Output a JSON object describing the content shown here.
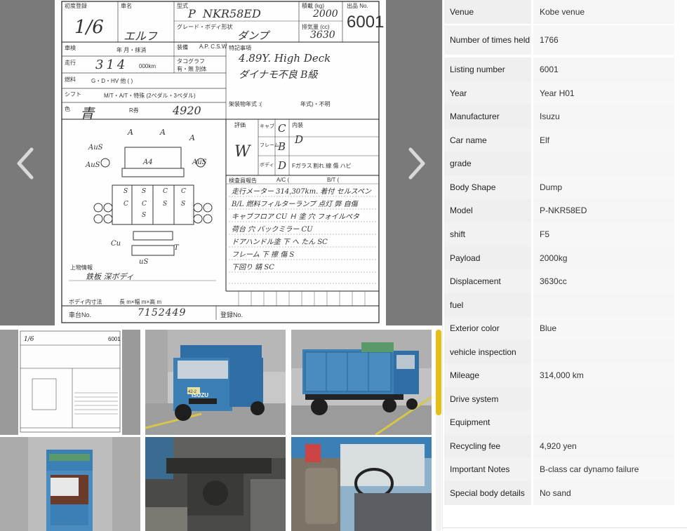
{
  "gallery": {
    "main_image": "auction-sheet",
    "prev_icon": "chevron-left-icon",
    "next_icon": "chevron-right-icon",
    "sheet": {
      "lot_number": "6001",
      "lot_header": "出品 No.",
      "reg_year_label": "初度登録",
      "reg_year_value": "1/6",
      "name_label": "車名",
      "name_value": "エルフ",
      "model_label": "型式",
      "model_value": "P  NKR58ED",
      "grade_label": "グレード・ボディ形状",
      "grade_value": "ダンプ",
      "payload_label": "積載 (kg)",
      "payload_value": "2000",
      "displacement_label": "排気量 (cc)",
      "displacement_value": "3630",
      "mileage_label": "走行",
      "mileage_value": "314",
      "mileage_unit": "000km",
      "shift_label": "シフト",
      "shift_value": "M/T・A/T・特殊 (2ペダル・3ペダル)",
      "fuel_label": "燃料",
      "fuel_value": "G・D・HV 他 (  )",
      "color_label": "色",
      "color_value": "青",
      "recycle_label": "R券",
      "recycle_value": "4920",
      "inspection_label": "車検",
      "inspection_value": "年 月・抹消",
      "equip_label": "装備",
      "equip_value": "A.P. C.S.W",
      "tacho_label": "タコグラフ",
      "tacho_value": "有・無 別体",
      "special_label": "特記事項",
      "special_value_1": "4.89Y. High Deck",
      "special_value_2": "ダイナモ不良 B級",
      "rack_label": "架装物年式 :(",
      "rack_value": "年式)・不明",
      "grade_score_label": "評価",
      "grade_score_value": "W",
      "cab_label": "キャブ",
      "cab_value": "C",
      "frame_label": "フレーム",
      "frame_value": "B",
      "body_label": "ボディ",
      "body_value": "D",
      "interior_label": "内装",
      "interior_value": "D",
      "glass_label": "Fガラス",
      "glass_value": "割れ 線 傷 ハビ",
      "report_label": "検査員報告",
      "report_ac": "A/C (",
      "report_bt": "B/T (",
      "report_lines": [
        "走行メーター 314,307km. 着付 セルスペン",
        "B/L 燃料フィルターランプ 点灯 弊 自傷",
        "キャブフロア CU Ｈ 塗 穴 フォイルペタ",
        "荷台 穴 バックミラー CU",
        "ドアハンドル塗 下 へ たん SC",
        "フレーム 下 擦 傷 S",
        "下回り 錆 SC"
      ],
      "upper_info_label": "上物情報",
      "upper_info_value": "鉄板 深ボディ",
      "body_dims_label": "ボディ内寸法",
      "body_dims_value": "長  m×幅  m×高  m",
      "chassis_label": "車台No.",
      "chassis_value": "7152449",
      "reg_label": "登録No.",
      "diagram_marks": [
        "A",
        "A",
        "A",
        "AuS",
        "AuS",
        "AuS",
        "A4",
        "S",
        "C",
        "S",
        "C",
        "S",
        "C",
        "S",
        "C",
        "S",
        "Cu",
        "T",
        "uS"
      ]
    },
    "thumbnails": [
      {
        "name": "thumb-auction-sheet"
      },
      {
        "name": "thumb-front-view"
      },
      {
        "name": "thumb-rear-view"
      },
      {
        "name": "thumb-bed-view"
      },
      {
        "name": "thumb-underbody-view"
      },
      {
        "name": "thumb-interior-view"
      }
    ],
    "thumb_front_badge": "ISUZU",
    "thumb_plate": "42-2"
  },
  "specs": [
    {
      "label": "Venue",
      "value": "Kobe venue"
    },
    {
      "label": "Number of times held",
      "value": "1766"
    },
    {
      "label": "Listing number",
      "value": "6001"
    },
    {
      "label": "Year",
      "value": "Year H01"
    },
    {
      "label": "Manufacturer",
      "value": "Isuzu"
    },
    {
      "label": "Car name",
      "value": "Elf"
    },
    {
      "label": "grade",
      "value": ""
    },
    {
      "label": "Body Shape",
      "value": "Dump"
    },
    {
      "label": "Model",
      "value": "P-NKR58ED"
    },
    {
      "label": "shift",
      "value": "F5"
    },
    {
      "label": "Payload",
      "value": "2000kg"
    },
    {
      "label": "Displacement",
      "value": "3630cc"
    },
    {
      "label": "fuel",
      "value": ""
    },
    {
      "label": "Exterior color",
      "value": "Blue"
    },
    {
      "label": "vehicle inspection",
      "value": ""
    },
    {
      "label": "Mileage",
      "value": "314,000 km"
    },
    {
      "label": "Drive system",
      "value": ""
    },
    {
      "label": "Equipment",
      "value": ""
    },
    {
      "label": "Recycling fee",
      "value": "4,920 yen"
    },
    {
      "label": "Important Notes",
      "value": "B-class car dynamo failure"
    },
    {
      "label": "Special body details",
      "value": "No sand"
    }
  ],
  "colors": {
    "viewer_bg": "#7a7a7a",
    "scrollbar": "#e7be15",
    "truck_blue": "#3c7fb5",
    "label_bg": "#efefef",
    "value_bg": "#f5f5f5"
  }
}
